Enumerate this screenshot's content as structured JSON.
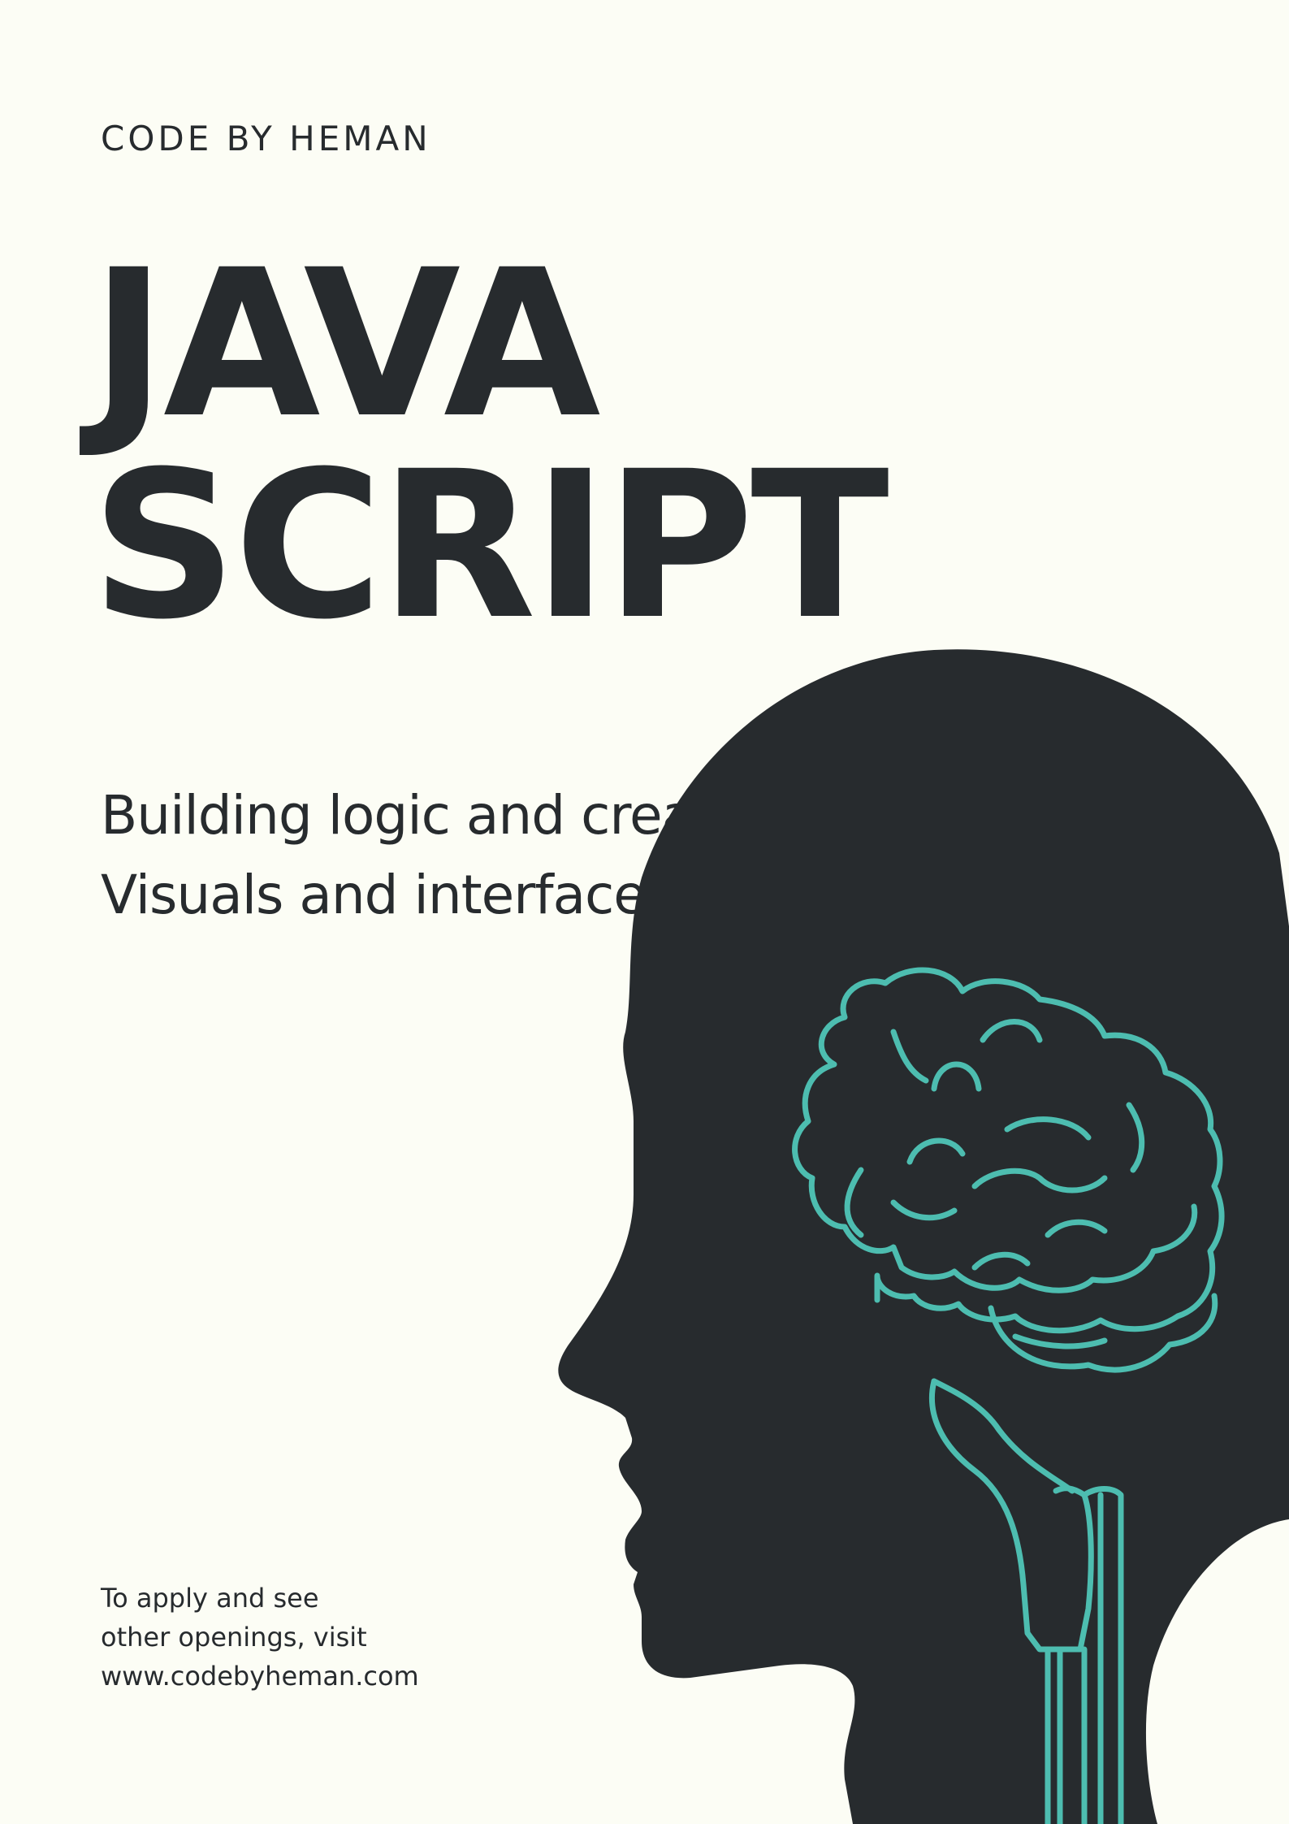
{
  "poster": {
    "brand": "CODE BY HEMAN",
    "title_line1": "JAVA",
    "title_line2": "SCRIPT",
    "subtitle_line1": "Building logic and create dynamic",
    "subtitle_line2": "Visuals and interface.",
    "apply_line1": "To apply and see",
    "apply_line2": "other openings, visit",
    "apply_line3": "www.codebyheman.com"
  },
  "illustration": {
    "icon": "head-with-brain-icon",
    "colors": {
      "background": "#fcfdf5",
      "silhouette": "#272b2e",
      "brain_outline": "#4dbdb0",
      "text": "#272b2e"
    }
  }
}
